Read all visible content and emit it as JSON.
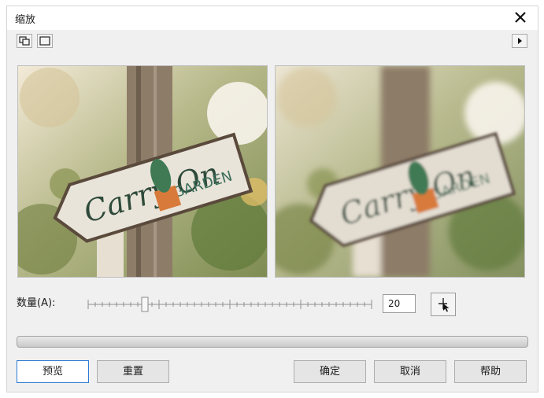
{
  "window": {
    "title": "缩放"
  },
  "toolbar": {
    "icons": [
      "split-preview-icon",
      "single-preview-icon",
      "play-arrow-icon"
    ]
  },
  "preview": {
    "original_sign_text": "Carry On",
    "original_sign_subtext": "GARDEN",
    "result_sign_text": "Carry On",
    "result_sign_subtext": "GARDEN"
  },
  "amount": {
    "label": "数量(A):",
    "value": "20",
    "min": 0,
    "max": 100,
    "level": 0.2
  },
  "progress": {
    "fraction": 0
  },
  "buttons": {
    "preview": "预览",
    "reset": "重置",
    "ok": "确定",
    "cancel": "取消",
    "help": "帮助"
  },
  "colors": {
    "accent": "#2a7bd4",
    "sign_text": "#2e4a3a",
    "pot": "#d87a3a",
    "cactus": "#3f7a55"
  }
}
